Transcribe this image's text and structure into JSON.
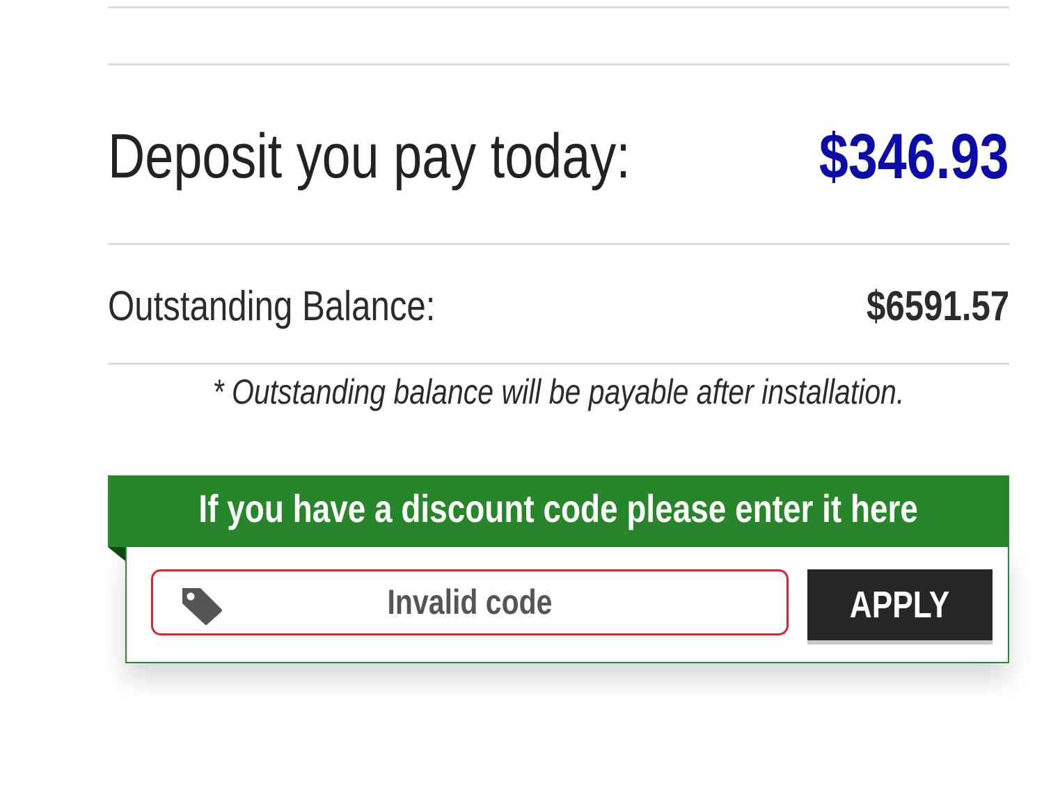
{
  "colors": {
    "deposit_amount": "#0c0ca8",
    "discount_header_bg": "#28862a",
    "error_border": "#dc2330",
    "apply_button_bg": "#262626"
  },
  "summary": {
    "deposit_label": "Deposit you pay today:",
    "deposit_amount": "$346.93",
    "balance_label": "Outstanding Balance:",
    "balance_amount": "$6591.57",
    "balance_note": "* Outstanding balance will be payable after installation."
  },
  "discount": {
    "header": "If you have a discount code please enter it here",
    "field_icon": "tag-icon",
    "field_value": "Invalid code",
    "field_state": "error",
    "apply_label": "APPLY"
  }
}
